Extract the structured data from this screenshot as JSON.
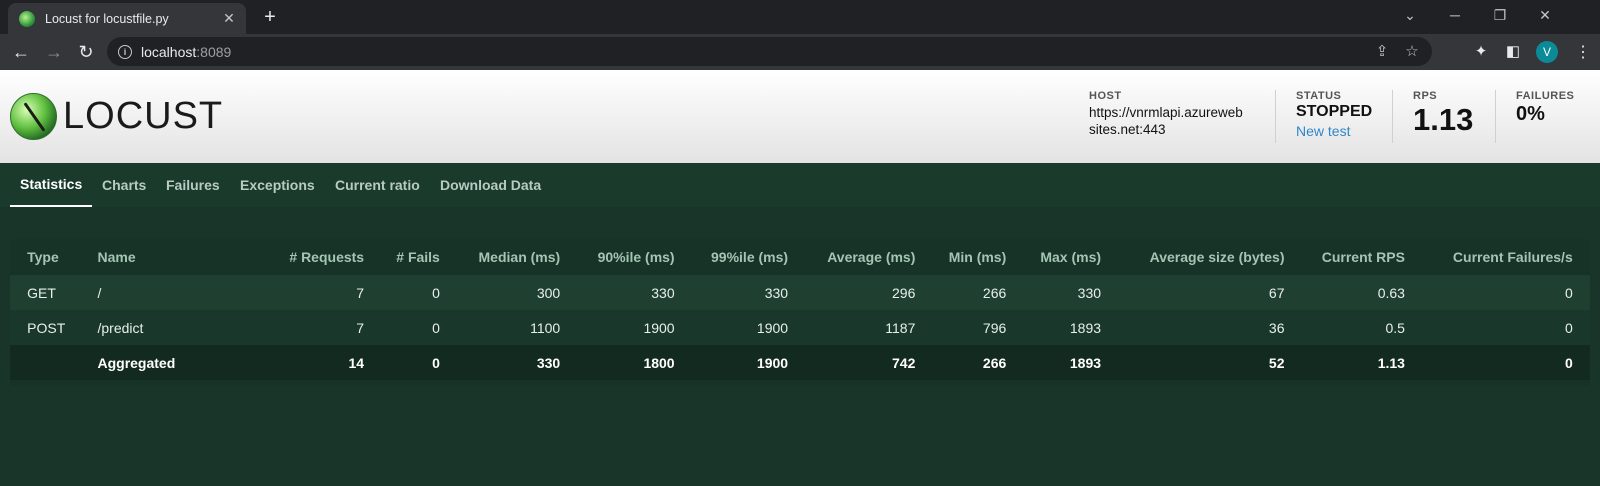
{
  "browser": {
    "tab_title": "Locust for locustfile.py",
    "url_host": "localhost",
    "url_port": ":8089",
    "avatar_letter": "V"
  },
  "header": {
    "logo_text": "LOCUST",
    "host_label": "HOST",
    "host_line1": "https://vnrmlapi.azureweb",
    "host_line2": "sites.net:443",
    "status_label": "STATUS",
    "status_value": "STOPPED",
    "new_test": "New test",
    "rps_label": "RPS",
    "rps_value": "1.13",
    "failures_label": "FAILURES",
    "failures_value": "0%"
  },
  "tabs": [
    "Statistics",
    "Charts",
    "Failures",
    "Exceptions",
    "Current ratio",
    "Download Data"
  ],
  "table": {
    "headers": [
      "Type",
      "Name",
      "# Requests",
      "# Fails",
      "Median (ms)",
      "90%ile (ms)",
      "99%ile (ms)",
      "Average (ms)",
      "Min (ms)",
      "Max (ms)",
      "Average size (bytes)",
      "Current RPS",
      "Current Failures/s"
    ],
    "rows": [
      [
        "GET",
        "/",
        "7",
        "0",
        "300",
        "330",
        "330",
        "296",
        "266",
        "330",
        "67",
        "0.63",
        "0"
      ],
      [
        "POST",
        "/predict",
        "7",
        "0",
        "1100",
        "1900",
        "1900",
        "1187",
        "796",
        "1893",
        "36",
        "0.5",
        "0"
      ],
      [
        "",
        "Aggregated",
        "14",
        "0",
        "330",
        "1800",
        "1900",
        "742",
        "266",
        "1893",
        "52",
        "1.13",
        "0"
      ]
    ]
  },
  "colors": {
    "page_bg": "#19352a",
    "accent_link": "#2f87c8"
  }
}
